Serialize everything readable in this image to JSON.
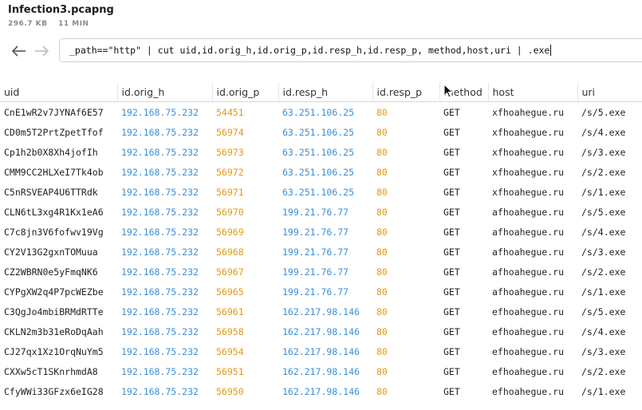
{
  "window": {
    "title": "Infection3.pcapng",
    "size": "296.7 KB",
    "duration": "11 MIN"
  },
  "query": {
    "text": "_path==\"http\" | cut uid,id.orig_h,id.orig_p,id.resp_h,id.resp_p, method,host,uri | .exe"
  },
  "nav": {
    "back_icon": "arrow-left-icon",
    "forward_icon": "arrow-right-icon"
  },
  "colors": {
    "ip": "#3d8fd6",
    "port": "#e09a1a"
  },
  "table": {
    "columns": [
      "uid",
      "id.orig_h",
      "id.orig_p",
      "id.resp_h",
      "id.resp_p",
      "method",
      "host",
      "uri"
    ],
    "rows": [
      [
        "CnE1wR2v7JYNAf6E57",
        "192.168.75.232",
        "54451",
        "63.251.106.25",
        "80",
        "GET",
        "xfhoahegue.ru",
        "/s/5.exe"
      ],
      [
        "CD0m5T2PrtZpetTfof",
        "192.168.75.232",
        "56974",
        "63.251.106.25",
        "80",
        "GET",
        "xfhoahegue.ru",
        "/s/4.exe"
      ],
      [
        "Cp1h2b0X8Xh4jofIh",
        "192.168.75.232",
        "56973",
        "63.251.106.25",
        "80",
        "GET",
        "xfhoahegue.ru",
        "/s/3.exe"
      ],
      [
        "CMM9CC2HLXeI7Tk4ob",
        "192.168.75.232",
        "56972",
        "63.251.106.25",
        "80",
        "GET",
        "xfhoahegue.ru",
        "/s/2.exe"
      ],
      [
        "C5nRSVEAP4U6TTRdk",
        "192.168.75.232",
        "56971",
        "63.251.106.25",
        "80",
        "GET",
        "xfhoahegue.ru",
        "/s/1.exe"
      ],
      [
        "CLN6tL3xg4R1Kx1eA6",
        "192.168.75.232",
        "56970",
        "199.21.76.77",
        "80",
        "GET",
        "afhoahegue.ru",
        "/s/5.exe"
      ],
      [
        "C7c8jn3V6fofwv19Vg",
        "192.168.75.232",
        "56969",
        "199.21.76.77",
        "80",
        "GET",
        "afhoahegue.ru",
        "/s/4.exe"
      ],
      [
        "CY2V13G2gxnTOMuua",
        "192.168.75.232",
        "56968",
        "199.21.76.77",
        "80",
        "GET",
        "afhoahegue.ru",
        "/s/3.exe"
      ],
      [
        "CZ2WBRN0e5yFmqNK6",
        "192.168.75.232",
        "56967",
        "199.21.76.77",
        "80",
        "GET",
        "afhoahegue.ru",
        "/s/2.exe"
      ],
      [
        "CYPgXW2q4P7pcWEZbe",
        "192.168.75.232",
        "56965",
        "199.21.76.77",
        "80",
        "GET",
        "afhoahegue.ru",
        "/s/1.exe"
      ],
      [
        "C3QgJo4mbiBRMdRTTe",
        "192.168.75.232",
        "56961",
        "162.217.98.146",
        "80",
        "GET",
        "efhoahegue.ru",
        "/s/5.exe"
      ],
      [
        "CKLN2m3b31eRoDqAah",
        "192.168.75.232",
        "56958",
        "162.217.98.146",
        "80",
        "GET",
        "efhoahegue.ru",
        "/s/4.exe"
      ],
      [
        "CJ27qx1Xz1OrqNuYm5",
        "192.168.75.232",
        "56954",
        "162.217.98.146",
        "80",
        "GET",
        "efhoahegue.ru",
        "/s/3.exe"
      ],
      [
        "CXXw5cT1SKnrhmdA8",
        "192.168.75.232",
        "56951",
        "162.217.98.146",
        "80",
        "GET",
        "efhoahegue.ru",
        "/s/2.exe"
      ],
      [
        "CfyWWi33GFzx6eIG28",
        "192.168.75.232",
        "56950",
        "162.217.98.146",
        "80",
        "GET",
        "efhoahegue.ru",
        "/s/1.exe"
      ]
    ]
  }
}
